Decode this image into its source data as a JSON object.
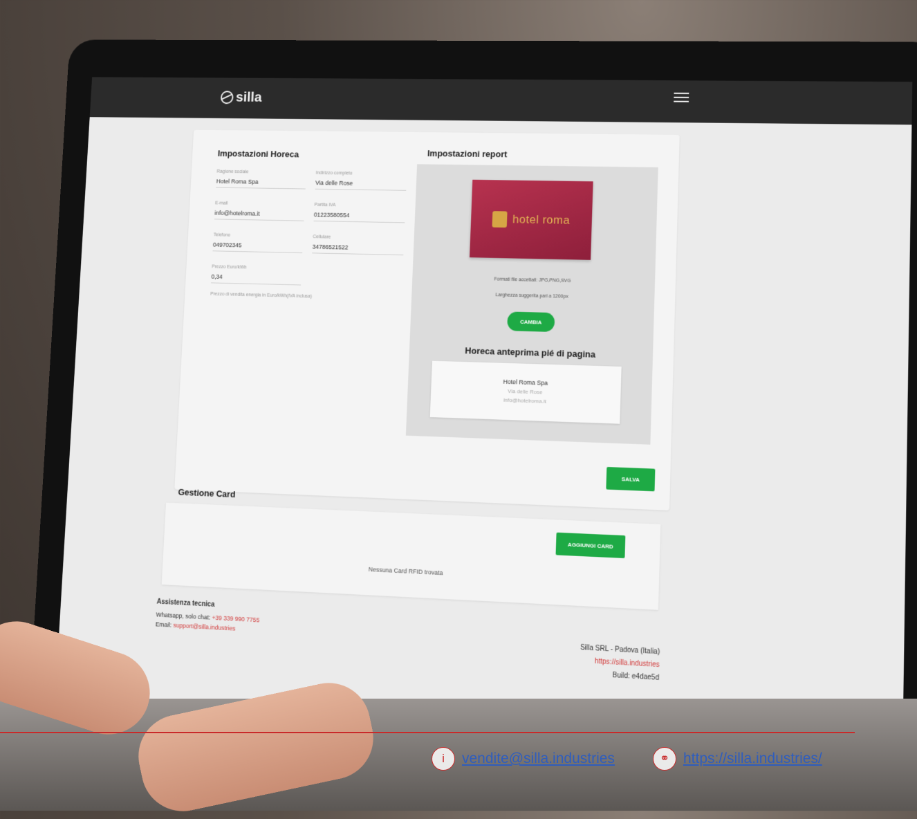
{
  "app": {
    "logo_text": "silla",
    "menu_icon": "hamburger-icon"
  },
  "horeca": {
    "title": "Impostazioni Horeca",
    "fields": [
      {
        "label": "Ragione sociale",
        "value": "Hotel Roma Spa"
      },
      {
        "label": "Indirizzo completo",
        "value": "Via delle Rose"
      },
      {
        "label": "E-mail",
        "value": "info@hotelroma.it"
      },
      {
        "label": "Partita IVA",
        "value": "01223580554"
      },
      {
        "label": "Telefono",
        "value": "049702345"
      },
      {
        "label": "Cellulare",
        "value": "34786521522"
      },
      {
        "label": "Prezzo Euro/kWh",
        "value": "0,34"
      }
    ],
    "price_hint": "Prezzo di vendita energia in Euro/kWh(IVA inclusa)"
  },
  "report": {
    "title": "Impostazioni report",
    "logo_text": "hotel roma",
    "formats": "Formati file accettati: JPG,PNG,SVG",
    "width_hint": "Larghezza suggerita pari a 1200px",
    "change_button": "CAMBIA",
    "preview_title": "Horeca anteprima pié di pagina",
    "preview_name": "Hotel Roma Spa",
    "preview_address": "Via delle Rose",
    "preview_email": "info@hotelroma.it"
  },
  "save_button": "SALVA",
  "gestione": {
    "title": "Gestione Card",
    "add_button": "AGGIUNGI CARD",
    "empty_text": "Nessuna Card RFID trovata"
  },
  "footer": {
    "support_title": "Assistenza tecnica",
    "whatsapp_label": "Whatsapp, solo chat:",
    "whatsapp_number": "+39 339 990 7755",
    "email_label": "Email:",
    "email_value": "support@silla.industries",
    "company": "Silla SRL - Padova (Italia)",
    "website": "https://silla.industries",
    "build": "Build: e4dae5d"
  },
  "bottom": {
    "email": "vendite@silla.industries",
    "website": "https://silla.industries/",
    "info_icon": "info-icon",
    "globe_icon": "globe-icon",
    "accent": "#c92a2a"
  }
}
